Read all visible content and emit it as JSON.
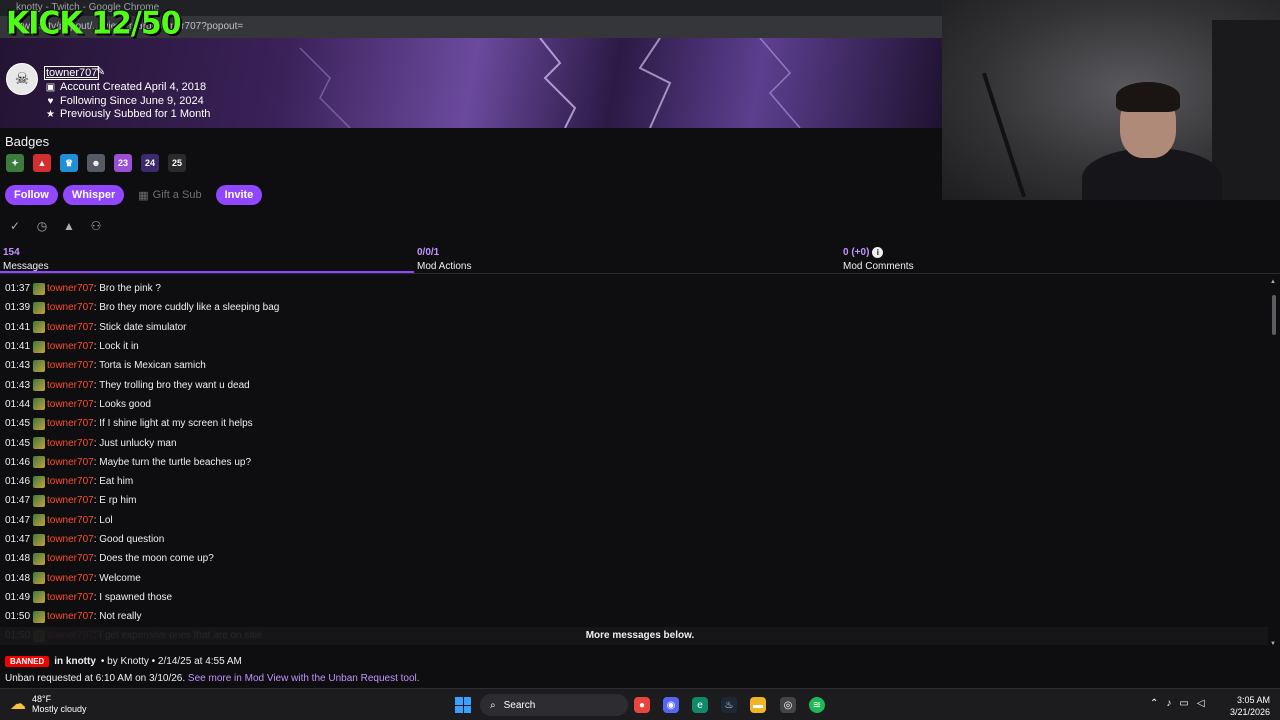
{
  "browser": {
    "title": "knotty - Twitch - Google Chrome",
    "url": "twitch.tv/popout/.../viewercard/towner707?popout="
  },
  "overlay": {
    "title": "KICK 12/50"
  },
  "profile": {
    "username": "towner707",
    "account_created": "Account Created April 4, 2018",
    "following_since": "Following Since June 9, 2024",
    "subbed": "Previously Subbed for 1 Month"
  },
  "badges_section": {
    "label": "Badges",
    "items": [
      {
        "icon": "vip-badge-icon",
        "color": "#3d7a3d",
        "glyph": "✦"
      },
      {
        "icon": "apex-badge-icon",
        "color": "#d22f2f",
        "glyph": "▲"
      },
      {
        "icon": "crown-badge-icon",
        "color": "#1f8fd6",
        "glyph": "♛"
      },
      {
        "icon": "mask-badge-icon",
        "color": "#555a66",
        "glyph": "☻"
      },
      {
        "icon": "year-23-badge-icon",
        "color": "#9b4fd6",
        "glyph": "23"
      },
      {
        "icon": "year-24-badge-icon",
        "color": "#3b2a6e",
        "glyph": "24"
      },
      {
        "icon": "year-25-badge-icon",
        "color": "#2a2a2e",
        "glyph": "25"
      }
    ]
  },
  "actions": {
    "follow": "Follow",
    "whisper": "Whisper",
    "gift_sub": "Gift a Sub",
    "invite": "Invite"
  },
  "stats": {
    "messages": {
      "value": "154",
      "label": "Messages"
    },
    "mod_actions": {
      "value": "0/0/1",
      "label": "Mod Actions"
    },
    "mod_comments": {
      "value": "0 (+0)",
      "label": "Mod Comments"
    }
  },
  "messages": [
    {
      "time": "01:37",
      "user": "towner707",
      "text": ": Bro the pink ?"
    },
    {
      "time": "01:39",
      "user": "towner707",
      "text": ": Bro they more cuddly like a sleeping bag"
    },
    {
      "time": "01:41",
      "user": "towner707",
      "text": ": Stick date simulator"
    },
    {
      "time": "01:41",
      "user": "towner707",
      "text": ": Lock it in"
    },
    {
      "time": "01:43",
      "user": "towner707",
      "text": ": Torta is Mexican samich"
    },
    {
      "time": "01:43",
      "user": "towner707",
      "text": ": They trolling bro they want u dead"
    },
    {
      "time": "01:44",
      "user": "towner707",
      "text": ": Looks good"
    },
    {
      "time": "01:45",
      "user": "towner707",
      "text": ": If I shine light at my screen it helps"
    },
    {
      "time": "01:45",
      "user": "towner707",
      "text": ": Just unlucky man"
    },
    {
      "time": "01:46",
      "user": "towner707",
      "text": ": Maybe turn the turtle beaches up?"
    },
    {
      "time": "01:46",
      "user": "towner707",
      "text": ": Eat him"
    },
    {
      "time": "01:47",
      "user": "towner707",
      "text": ": E rp him"
    },
    {
      "time": "01:47",
      "user": "towner707",
      "text": ": Lol"
    },
    {
      "time": "01:47",
      "user": "towner707",
      "text": ": Good question"
    },
    {
      "time": "01:48",
      "user": "towner707",
      "text": ": Does the moon come up?"
    },
    {
      "time": "01:48",
      "user": "towner707",
      "text": ": Welcome"
    },
    {
      "time": "01:49",
      "user": "towner707",
      "text": ": I spawned those"
    },
    {
      "time": "01:50",
      "user": "towner707",
      "text": ": Not really"
    },
    {
      "time": "01:50",
      "user": "towner707",
      "text": ": I get expensive ones that are on sale"
    }
  ],
  "more_messages": "More messages below.",
  "ban": {
    "badge": "BANNED",
    "channel": "in knotty",
    "by": "• by Knotty • 2/14/25 at 4:55 AM",
    "unban_text": "Unban requested at 6:10 AM on 3/10/26.",
    "unban_link": "See more in Mod View with the Unban Request tool."
  },
  "taskbar": {
    "temp": "48°F",
    "weather": "Mostly cloudy",
    "search": "Search",
    "time": "3:05 AM",
    "date": "3/21/2026"
  }
}
